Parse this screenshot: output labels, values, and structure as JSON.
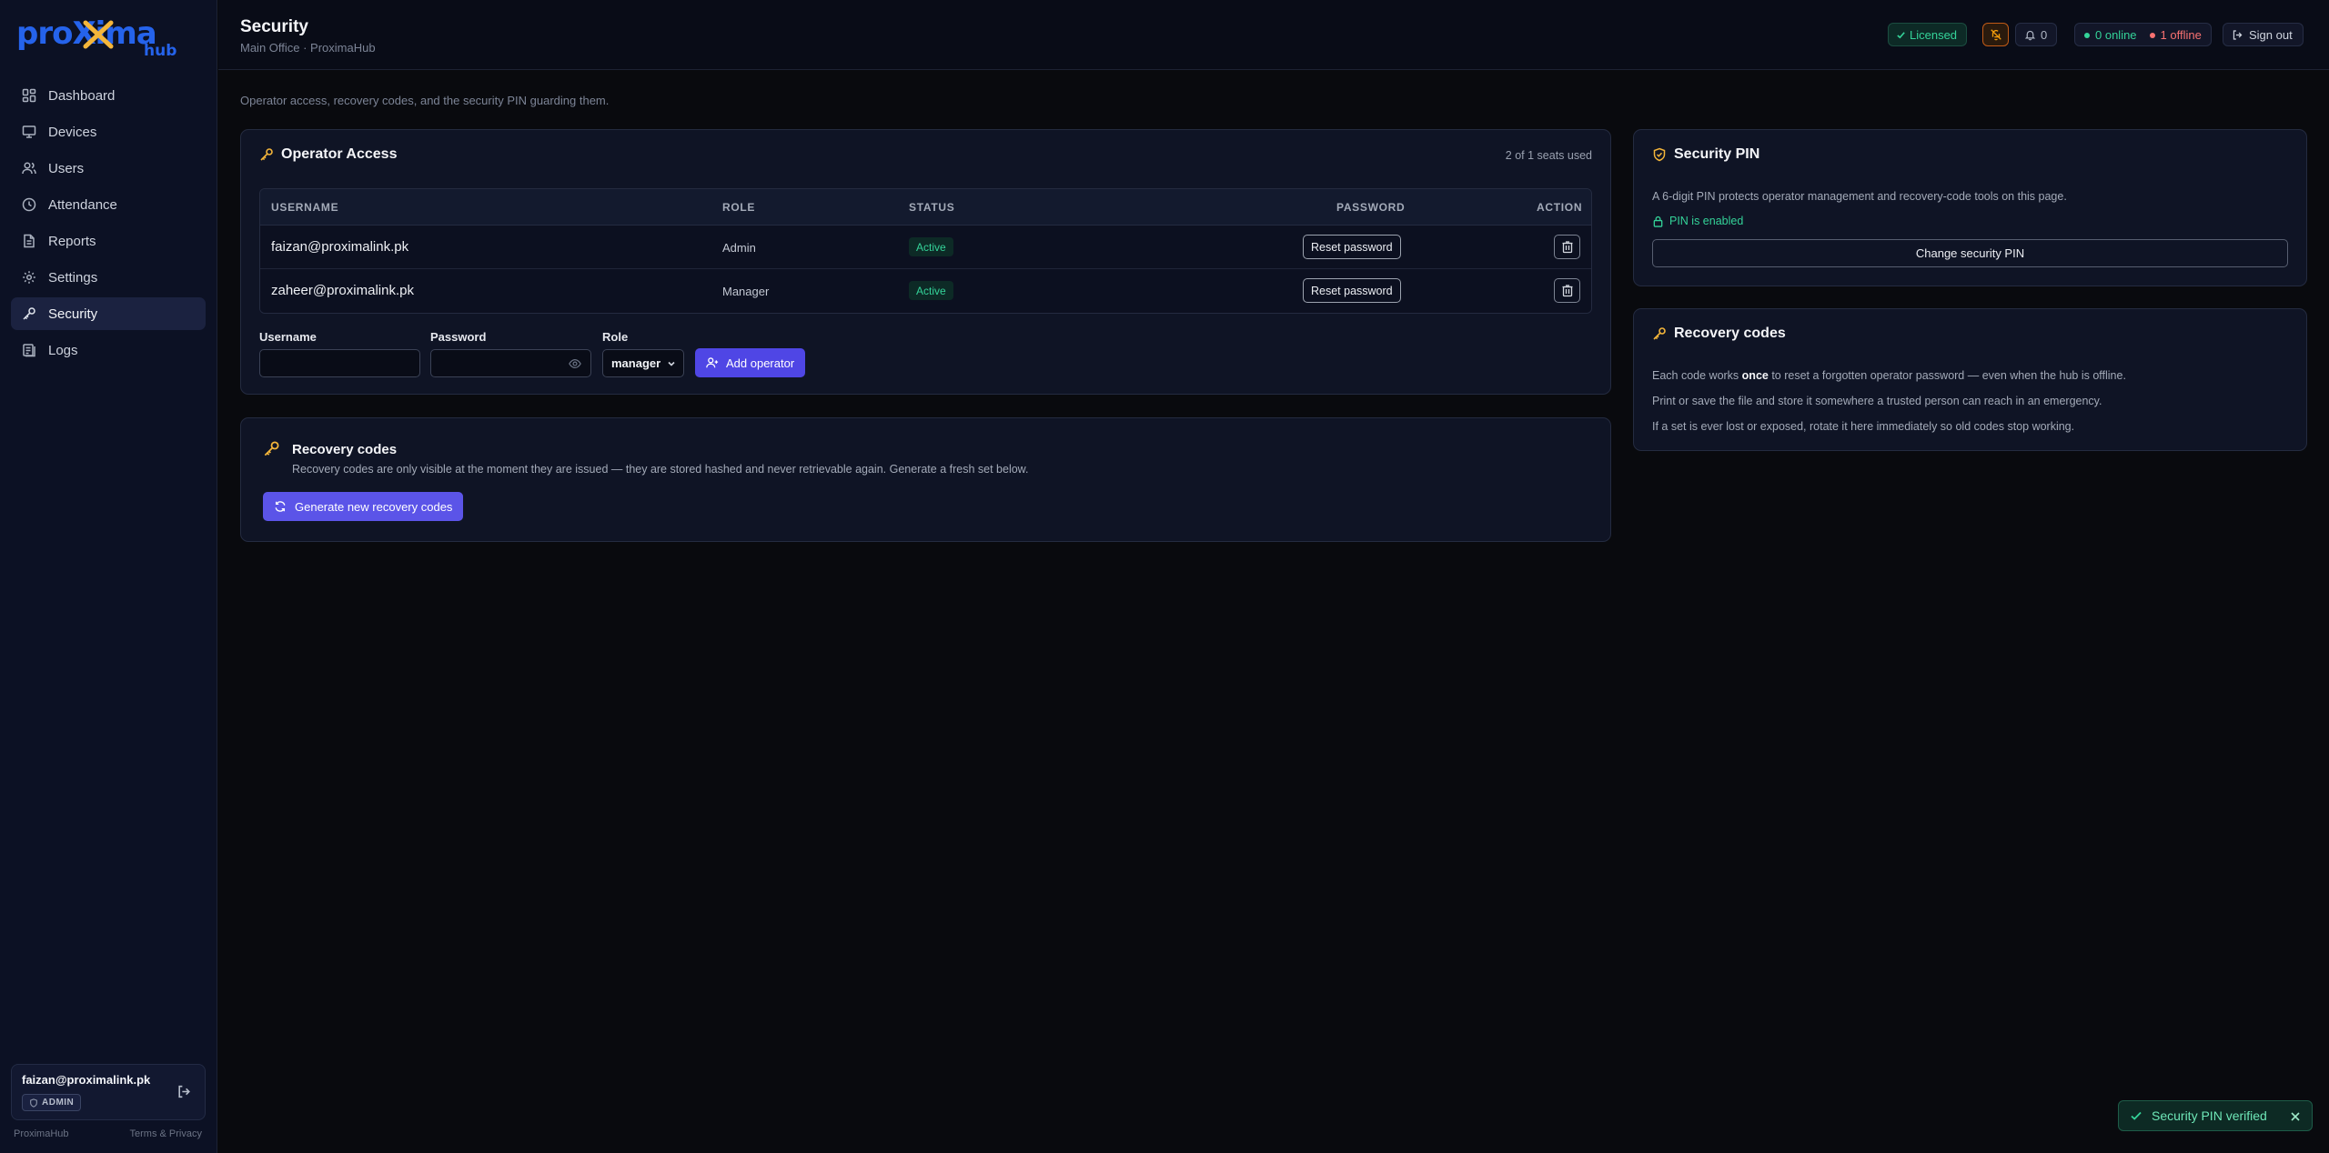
{
  "brand": {
    "logo_main": "proXima",
    "logo_sub": "hub"
  },
  "sidebar": {
    "items": [
      {
        "label": "Dashboard",
        "icon": "grid-icon"
      },
      {
        "label": "Devices",
        "icon": "monitor-icon"
      },
      {
        "label": "Users",
        "icon": "users-icon"
      },
      {
        "label": "Attendance",
        "icon": "clock-icon"
      },
      {
        "label": "Reports",
        "icon": "file-icon"
      },
      {
        "label": "Settings",
        "icon": "gear-icon"
      },
      {
        "label": "Security",
        "icon": "key-icon",
        "active": true
      },
      {
        "label": "Logs",
        "icon": "logs-icon"
      }
    ],
    "user": {
      "email": "faizan@proximalink.pk",
      "role": "ADMIN"
    },
    "footer_left": "ProximaHub",
    "footer_right": "Terms & Privacy"
  },
  "header": {
    "title": "Security",
    "subtitle": "Main Office · ProximaHub",
    "licensed": "Licensed",
    "notifications": "0",
    "online": "0 online",
    "offline": "1 offline",
    "signout": "Sign out"
  },
  "intro": "Operator access, recovery codes, and the security PIN guarding them.",
  "operators": {
    "title": "Operator Access",
    "seats": "2 of 1 seats used",
    "columns": {
      "username": "USERNAME",
      "role": "ROLE",
      "status": "STATUS",
      "password": "PASSWORD",
      "action": "ACTION"
    },
    "rows": [
      {
        "username": "faizan@proximalink.pk",
        "role": "Admin",
        "status": "Active",
        "reset": "Reset password"
      },
      {
        "username": "zaheer@proximalink.pk",
        "role": "Manager",
        "status": "Active",
        "reset": "Reset password"
      }
    ],
    "form": {
      "username_label": "Username",
      "username_value": "",
      "password_label": "Password",
      "password_value": "",
      "role_label": "Role",
      "role_value": "manager",
      "add_label": "Add operator"
    }
  },
  "recovery_left": {
    "title": "Recovery codes",
    "description": "Recovery codes are only visible at the moment they are issued — they are stored hashed and never retrievable again. Generate a fresh set below.",
    "button": "Generate new recovery codes"
  },
  "pin": {
    "title": "Security PIN",
    "description": "A 6-digit PIN protects operator management and recovery-code tools on this page.",
    "status": "PIN is enabled",
    "button": "Change security PIN"
  },
  "recovery_right": {
    "title": "Recovery codes",
    "line1_pre": "Each code works ",
    "line1_bold": "once",
    "line1_post": " to reset a forgotten operator password — even when the hub is offline.",
    "line2": "Print or save the file and store it somewhere a trusted person can reach in an emergency.",
    "line3": "If a set is ever lost or exposed, rotate it here immediately so old codes stop working."
  },
  "toast": {
    "message": "Security PIN verified"
  },
  "colors": {
    "accent": "#4f46e5",
    "success": "#34d399",
    "danger": "#f87171",
    "warning": "#f5b63a"
  }
}
